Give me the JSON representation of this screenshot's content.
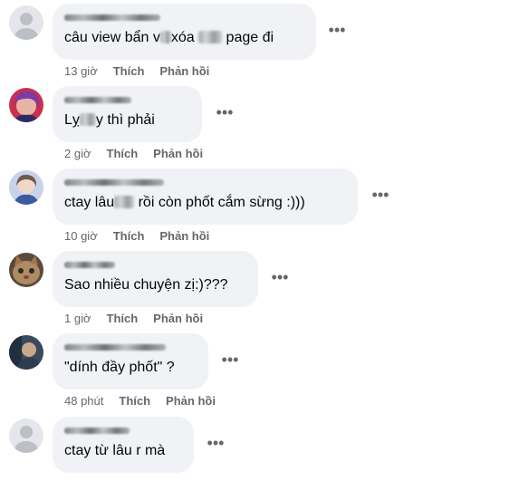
{
  "comments": [
    {
      "text": "câu view bẩn v_ xóa _ page đi",
      "text_parts": [
        "câu view bẩn v",
        "xóa ",
        " page đi"
      ],
      "time": "13 giờ",
      "like": "Thích",
      "reply": "Phản hồi",
      "avatar": "default-avatar"
    },
    {
      "text_parts": [
        "Lỵ",
        "y thì phải"
      ],
      "time": "2 giờ",
      "like": "Thích",
      "reply": "Phản hồi",
      "avatar": "profile-photo"
    },
    {
      "text_parts": [
        "ctay lâu",
        " rồi còn phốt cắm sừng :)))"
      ],
      "time": "10 giờ",
      "like": "Thích",
      "reply": "Phản hồi",
      "avatar": "profile-photo"
    },
    {
      "text": "Sao nhiều chuyện zị:)???",
      "time": "1 giờ",
      "like": "Thích",
      "reply": "Phản hồi",
      "avatar": "cat-photo"
    },
    {
      "text": "\"dính đầy phốt\" ?",
      "time": "48 phút",
      "like": "Thích",
      "reply": "Phản hồi",
      "avatar": "profile-photo"
    },
    {
      "text": "ctay từ lâu r mà",
      "time": "",
      "like": "",
      "reply": "",
      "avatar": "default-avatar"
    }
  ],
  "more_icon": "more-horizontal-icon"
}
